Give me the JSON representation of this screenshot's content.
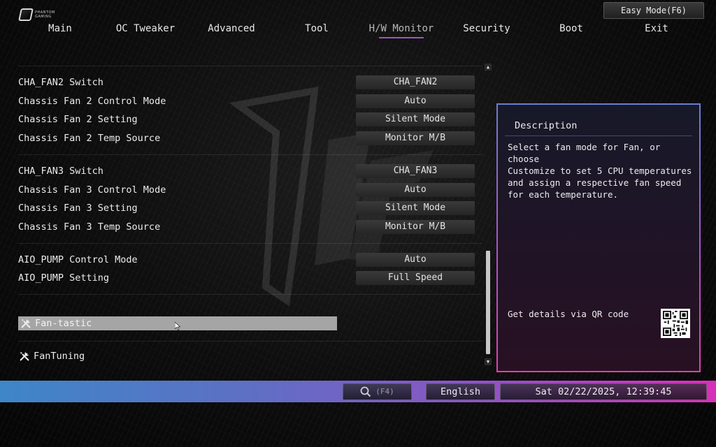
{
  "header": {
    "logo_line1": "PHANTOM",
    "logo_line2": "GAMING",
    "easy_mode_label": "Easy Mode(F6)"
  },
  "menu": {
    "items": [
      {
        "label": "Main"
      },
      {
        "label": "OC Tweaker"
      },
      {
        "label": "Advanced"
      },
      {
        "label": "Tool"
      },
      {
        "label": "H/W Monitor",
        "active": true
      },
      {
        "label": "Security"
      },
      {
        "label": "Boot"
      },
      {
        "label": "Exit"
      }
    ]
  },
  "settings": {
    "rows": [
      {
        "label": "CHA_FAN2 Switch",
        "value": "CHA_FAN2"
      },
      {
        "label": "Chassis Fan 2 Control Mode",
        "value": "Auto"
      },
      {
        "label": "Chassis Fan 2 Setting",
        "value": "Silent Mode"
      },
      {
        "label": "Chassis Fan 2 Temp Source",
        "value": "Monitor M/B"
      },
      {
        "label": "CHA_FAN3 Switch",
        "value": "CHA_FAN3"
      },
      {
        "label": "Chassis Fan 3 Control Mode",
        "value": "Auto"
      },
      {
        "label": "Chassis Fan 3 Setting",
        "value": "Silent Mode"
      },
      {
        "label": "Chassis Fan 3 Temp Source",
        "value": "Monitor M/B"
      },
      {
        "label": "AIO_PUMP Control Mode",
        "value": "Auto"
      },
      {
        "label": "AIO_PUMP Setting",
        "value": "Full Speed"
      }
    ],
    "tools": [
      {
        "label": "Fan-tastic",
        "selected": true
      },
      {
        "label": "FanTuning"
      }
    ]
  },
  "description": {
    "title": "Description",
    "text": "Select a fan mode for Fan, or choose\nCustomize to set 5 CPU temperatures\nand assign a respective fan speed\nfor each temperature.",
    "qr_label": "Get details via QR code"
  },
  "bottom_bar": {
    "search_key": "(F4)",
    "language": "English",
    "datetime": "Sat 02/22/2025, 12:39:45"
  },
  "colors": {
    "accent_purple": "#a054c8",
    "panel_border_top": "#6a7dd4",
    "panel_border_bottom": "#e040b0",
    "bar_left": "#3e86c8",
    "bar_right": "#d830b8",
    "selected_row": "#a5a5a5"
  },
  "icons": {
    "tool": "wrench-screwdriver-icon",
    "search": "search-icon",
    "qr": "qr-code-icon"
  }
}
